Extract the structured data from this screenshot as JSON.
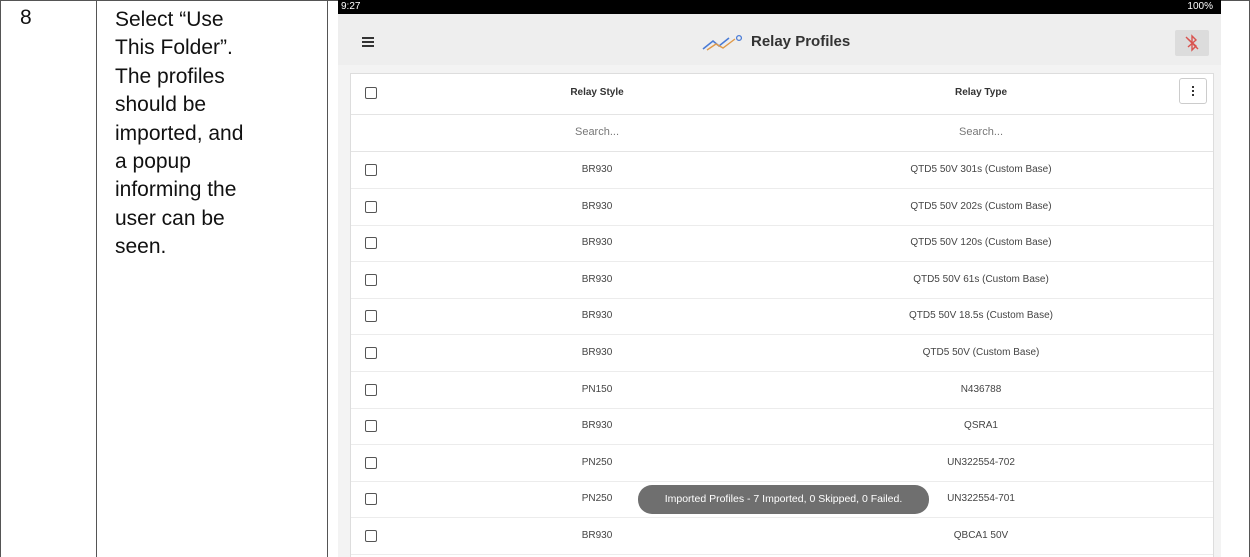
{
  "step": {
    "number": "8",
    "lines": [
      "Select “Use",
      "This Folder”.",
      "The profiles",
      "should be",
      "imported, and",
      "a popup",
      "informing the",
      "user can be",
      "seen."
    ]
  },
  "statusbar": {
    "time": "9:27",
    "right": "100%"
  },
  "app": {
    "title": "Relay Profiles",
    "brand_color": "#4a7bd6",
    "bt_icon_color": "#d9534f"
  },
  "table": {
    "headers": {
      "style": "Relay Style",
      "type": "Relay Type"
    },
    "search": {
      "style": "Search...",
      "type": "Search..."
    },
    "rows": [
      {
        "style": "BR930",
        "type": "QTD5 50V 301s (Custom Base)"
      },
      {
        "style": "BR930",
        "type": "QTD5 50V 202s (Custom Base)"
      },
      {
        "style": "BR930",
        "type": "QTD5 50V 120s (Custom Base)"
      },
      {
        "style": "BR930",
        "type": "QTD5 50V 61s (Custom Base)"
      },
      {
        "style": "BR930",
        "type": "QTD5 50V 18.5s (Custom Base)"
      },
      {
        "style": "BR930",
        "type": "QTD5 50V (Custom Base)"
      },
      {
        "style": "PN150",
        "type": "N436788"
      },
      {
        "style": "BR930",
        "type": "QSRA1"
      },
      {
        "style": "PN250",
        "type": "UN322554-702"
      },
      {
        "style": "PN250",
        "type": "UN322554-701"
      },
      {
        "style": "BR930",
        "type": "QBCA1 50V"
      }
    ]
  },
  "toast": {
    "text": "Imported Profiles - 7 Imported, 0 Skipped, 0 Failed."
  }
}
